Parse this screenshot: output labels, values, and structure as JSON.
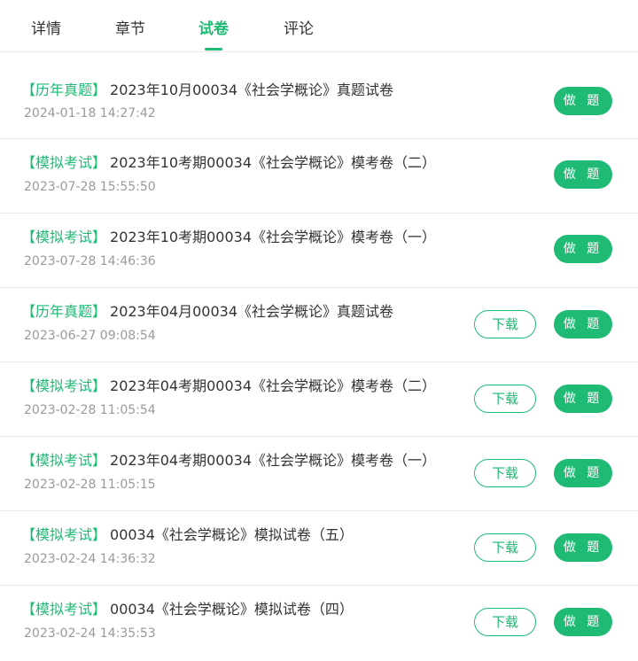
{
  "tabs": [
    {
      "label": "详情",
      "active": false
    },
    {
      "label": "章节",
      "active": false
    },
    {
      "label": "试卷",
      "active": true
    },
    {
      "label": "评论",
      "active": false
    }
  ],
  "accent_color": "#1fba74",
  "buttons": {
    "do_label": "做 题",
    "download_label": "下载"
  },
  "papers": [
    {
      "tag": "【历年真题】",
      "title": "2023年10月00034《社会学概论》真题试卷",
      "date": "2024-01-18 14:27:42",
      "downloadable": false
    },
    {
      "tag": "【模拟考试】",
      "title": "2023年10考期00034《社会学概论》模考卷（二）",
      "date": "2023-07-28 15:55:50",
      "downloadable": false
    },
    {
      "tag": "【模拟考试】",
      "title": "2023年10考期00034《社会学概论》模考卷（一）",
      "date": "2023-07-28 14:46:36",
      "downloadable": false
    },
    {
      "tag": "【历年真题】",
      "title": "2023年04月00034《社会学概论》真题试卷",
      "date": "2023-06-27 09:08:54",
      "downloadable": true
    },
    {
      "tag": "【模拟考试】",
      "title": "2023年04考期00034《社会学概论》模考卷（二）",
      "date": "2023-02-28 11:05:54",
      "downloadable": true
    },
    {
      "tag": "【模拟考试】",
      "title": "2023年04考期00034《社会学概论》模考卷（一）",
      "date": "2023-02-28 11:05:15",
      "downloadable": true
    },
    {
      "tag": "【模拟考试】",
      "title": "00034《社会学概论》模拟试卷（五）",
      "date": "2023-02-24 14:36:32",
      "downloadable": true
    },
    {
      "tag": "【模拟考试】",
      "title": "00034《社会学概论》模拟试卷（四）",
      "date": "2023-02-24 14:35:53",
      "downloadable": true
    }
  ]
}
